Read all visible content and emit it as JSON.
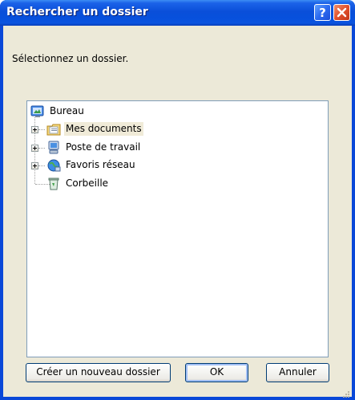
{
  "window": {
    "title": "Rechercher un dossier"
  },
  "title_buttons": {
    "help_icon": "help-icon",
    "close_icon": "close-icon"
  },
  "prompt": "Sélectionnez un dossier.",
  "tree": {
    "root": {
      "label": "Bureau",
      "icon": "desktop-icon"
    },
    "children": [
      {
        "label": "Mes documents",
        "icon": "my-documents-icon",
        "selected": true,
        "expandable": true
      },
      {
        "label": "Poste de travail",
        "icon": "my-computer-icon",
        "selected": false,
        "expandable": true
      },
      {
        "label": "Favoris réseau",
        "icon": "network-places-icon",
        "selected": false,
        "expandable": true
      },
      {
        "label": "Corbeille",
        "icon": "recycle-bin-icon",
        "selected": false,
        "expandable": false
      }
    ]
  },
  "buttons": {
    "new_folder": "Créer un nouveau dossier",
    "ok": "OK",
    "cancel": "Annuler"
  }
}
